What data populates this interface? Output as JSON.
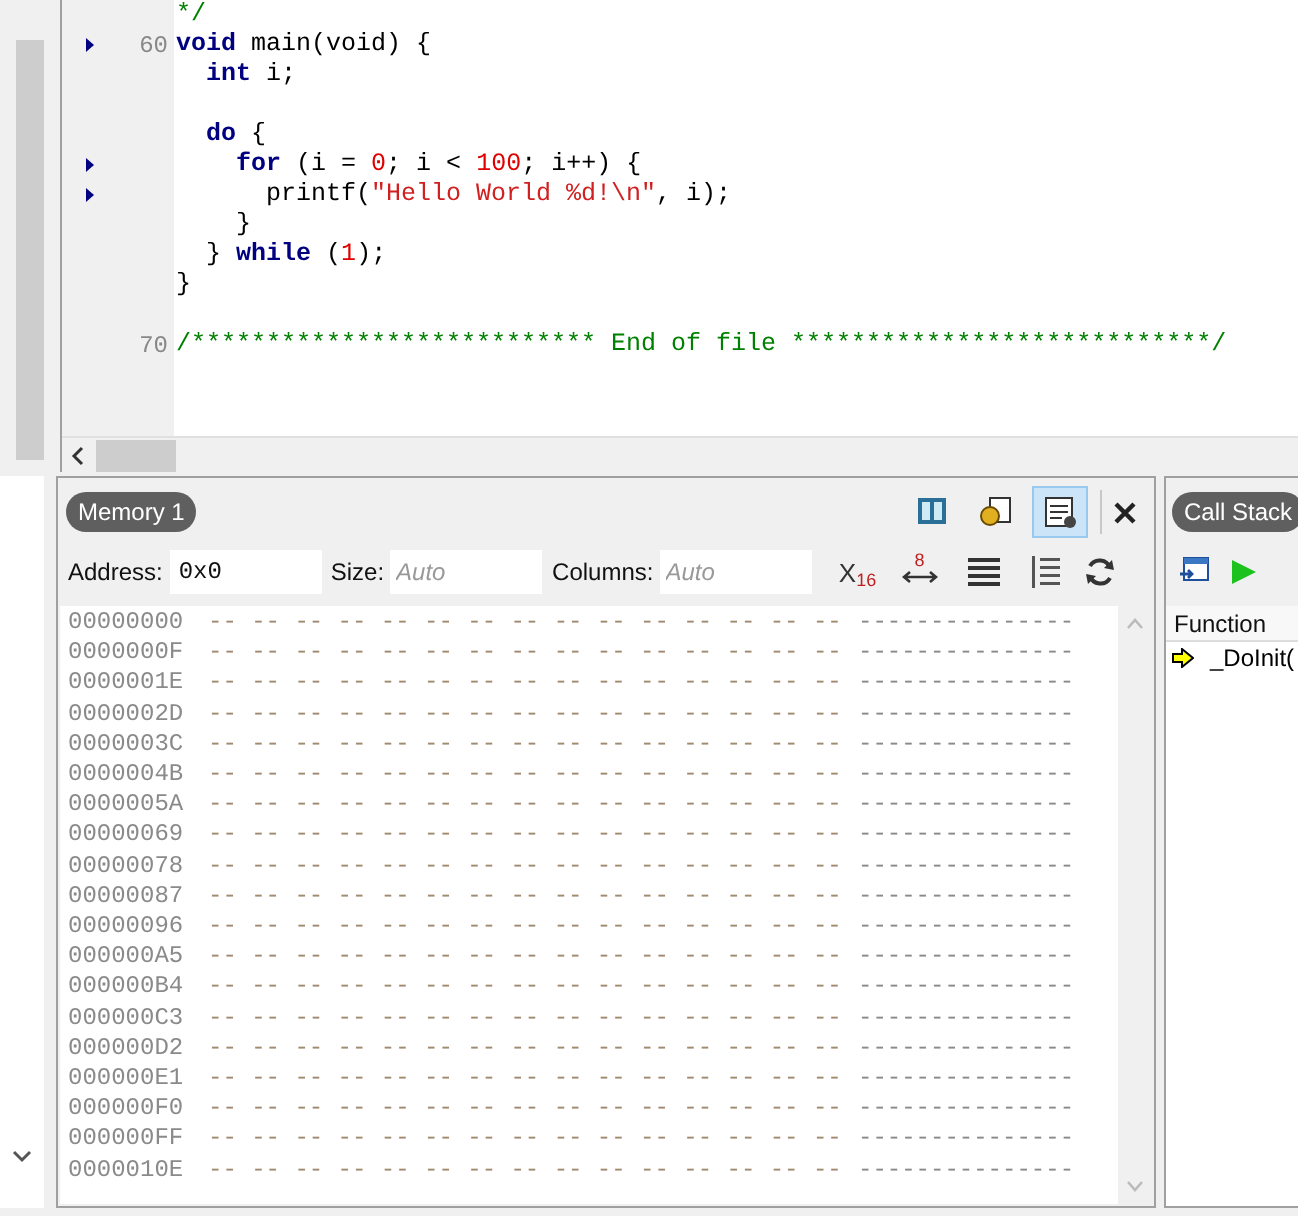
{
  "editor": {
    "lines": [
      {
        "kind": "code",
        "marker": false,
        "tokens": [
          {
            "kind": "comment",
            "text": "*/"
          }
        ]
      },
      {
        "kind": "code",
        "number": "60",
        "marker": true,
        "tokens": [
          {
            "kind": "keyword",
            "text": "void"
          },
          {
            "kind": "plain",
            "text": " main(void) {"
          }
        ],
        "children": [
          {
            "kind": "code",
            "marker": false,
            "tokens": [
              {
                "kind": "keyword",
                "text": "int"
              },
              {
                "kind": "plain",
                "text": " i;"
              }
            ]
          },
          {
            "kind": "blank"
          },
          {
            "kind": "code",
            "marker": false,
            "tokens": [
              {
                "kind": "keyword",
                "text": "do"
              },
              {
                "kind": "plain",
                "text": " {"
              }
            ],
            "children": [
              {
                "kind": "code",
                "marker": true,
                "tokens": [
                  {
                    "kind": "keyword",
                    "text": "for"
                  },
                  {
                    "kind": "plain",
                    "text": " (i = "
                  },
                  {
                    "kind": "number",
                    "text": "0"
                  },
                  {
                    "kind": "plain",
                    "text": "; i < "
                  },
                  {
                    "kind": "number",
                    "text": "100"
                  },
                  {
                    "kind": "plain",
                    "text": "; i++) {"
                  }
                ],
                "children": [
                  {
                    "kind": "code",
                    "marker": true,
                    "tokens": [
                      {
                        "kind": "plain",
                        "text": "printf("
                      },
                      {
                        "kind": "string",
                        "text": "\"Hello World %d!\\n\""
                      },
                      {
                        "kind": "plain",
                        "text": ", i);"
                      }
                    ]
                  }
                ]
              },
              {
                "kind": "code",
                "marker": false,
                "tokens": [
                  {
                    "kind": "plain",
                    "text": "}"
                  }
                ]
              }
            ]
          },
          {
            "kind": "code",
            "marker": false,
            "tokens": [
              {
                "kind": "plain",
                "text": "} "
              },
              {
                "kind": "keyword",
                "text": "while"
              },
              {
                "kind": "plain",
                "text": " ("
              },
              {
                "kind": "number",
                "text": "1"
              },
              {
                "kind": "plain",
                "text": ");"
              }
            ]
          }
        ]
      },
      {
        "kind": "code",
        "marker": false,
        "tokens": [
          {
            "kind": "plain",
            "text": "}"
          }
        ]
      },
      {
        "kind": "blank"
      },
      {
        "kind": "code",
        "number": "70",
        "marker": false,
        "tokens": [
          {
            "kind": "comment",
            "text": "/*************************** End of file ****************************/"
          }
        ]
      }
    ]
  },
  "memory": {
    "title": "Memory 1",
    "address_label": "Address:",
    "address": "0x0",
    "size_label": "Size:",
    "size_placeholder": "Auto",
    "columns_label": "Columns:",
    "columns_placeholder": "Auto",
    "x16": {
      "x": "X",
      "sub": "16"
    },
    "width_label": "8",
    "rows": [
      {
        "address": "00000000",
        "bytes": "-- -- -- -- -- -- -- -- -- -- -- -- -- -- --",
        "ascii": "---------------"
      },
      {
        "address": "0000000F",
        "bytes": "-- -- -- -- -- -- -- -- -- -- -- -- -- -- --",
        "ascii": "---------------"
      },
      {
        "address": "0000001E",
        "bytes": "-- -- -- -- -- -- -- -- -- -- -- -- -- -- --",
        "ascii": "---------------"
      },
      {
        "address": "0000002D",
        "bytes": "-- -- -- -- -- -- -- -- -- -- -- -- -- -- --",
        "ascii": "---------------"
      },
      {
        "address": "0000003C",
        "bytes": "-- -- -- -- -- -- -- -- -- -- -- -- -- -- --",
        "ascii": "---------------"
      },
      {
        "address": "0000004B",
        "bytes": "-- -- -- -- -- -- -- -- -- -- -- -- -- -- --",
        "ascii": "---------------"
      },
      {
        "address": "0000005A",
        "bytes": "-- -- -- -- -- -- -- -- -- -- -- -- -- -- --",
        "ascii": "---------------"
      },
      {
        "address": "00000069",
        "bytes": "-- -- -- -- -- -- -- -- -- -- -- -- -- -- --",
        "ascii": "---------------"
      },
      {
        "address": "00000078",
        "bytes": "-- -- -- -- -- -- -- -- -- -- -- -- -- -- --",
        "ascii": "---------------"
      },
      {
        "address": "00000087",
        "bytes": "-- -- -- -- -- -- -- -- -- -- -- -- -- -- --",
        "ascii": "---------------"
      },
      {
        "address": "00000096",
        "bytes": "-- -- -- -- -- -- -- -- -- -- -- -- -- -- --",
        "ascii": "---------------"
      },
      {
        "address": "000000A5",
        "bytes": "-- -- -- -- -- -- -- -- -- -- -- -- -- -- --",
        "ascii": "---------------"
      },
      {
        "address": "000000B4",
        "bytes": "-- -- -- -- -- -- -- -- -- -- -- -- -- -- --",
        "ascii": "---------------"
      },
      {
        "address": "000000C3",
        "bytes": "-- -- -- -- -- -- -- -- -- -- -- -- -- -- --",
        "ascii": "---------------"
      },
      {
        "address": "000000D2",
        "bytes": "-- -- -- -- -- -- -- -- -- -- -- -- -- -- --",
        "ascii": "---------------"
      },
      {
        "address": "000000E1",
        "bytes": "-- -- -- -- -- -- -- -- -- -- -- -- -- -- --",
        "ascii": "---------------"
      },
      {
        "address": "000000F0",
        "bytes": "-- -- -- -- -- -- -- -- -- -- -- -- -- -- --",
        "ascii": "---------------"
      },
      {
        "address": "000000FF",
        "bytes": "-- -- -- -- -- -- -- -- -- -- -- -- -- -- --",
        "ascii": "---------------"
      },
      {
        "address": "0000010E",
        "bytes": "-- -- -- -- -- -- -- -- -- -- -- -- -- -- --",
        "ascii": "---------------"
      }
    ],
    "tools": [
      {
        "selected": false
      },
      {
        "selected": false
      },
      {
        "selected": true
      }
    ]
  },
  "call_stack": {
    "title": "Call Stack",
    "column": "Function",
    "rows": [
      {
        "function": "_DoInit("
      }
    ]
  }
}
